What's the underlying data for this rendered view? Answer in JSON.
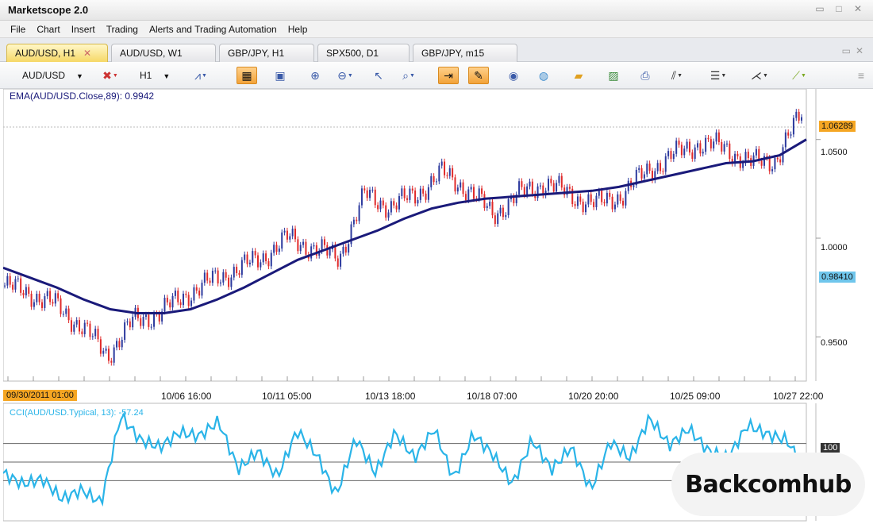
{
  "window": {
    "title": "Marketscope 2.0"
  },
  "menu": [
    "File",
    "Chart",
    "Insert",
    "Trading",
    "Alerts and Trading Automation",
    "Help"
  ],
  "tabs": [
    {
      "label": "AUD/USD, H1",
      "active": true
    },
    {
      "label": "AUD/USD, W1",
      "active": false
    },
    {
      "label": "GBP/JPY, H1",
      "active": false
    },
    {
      "label": "SPX500, D1",
      "active": false
    },
    {
      "label": "GBP/JPY, m15",
      "active": false
    }
  ],
  "toolbar": {
    "instrument": "AUD/USD",
    "timeframe": "H1"
  },
  "main_panel": {
    "indicator_label": "EMA(AUD/USD.Close,89): 0.9942",
    "y_axis_labels": [
      "1.0500",
      "1.0000",
      "0.9500"
    ],
    "price_tags": [
      {
        "text": "1.06289",
        "color": "#f5a623"
      },
      {
        "text": "0.98410",
        "color": "#6fc6ec"
      }
    ],
    "x_axis_labels": [
      "09/30/2011 01:00",
      "10/06 16:00",
      "10/11 05:00",
      "10/13 18:00",
      "10/18 07:00",
      "10/20 20:00",
      "10/25 09:00",
      "10/27 22:00"
    ],
    "ema_color": "#1a1a7a",
    "bull_color": "#2c3a9e",
    "bear_color": "#e02a2a"
  },
  "cci_panel": {
    "indicator_label": "CCI(AUD/USD.Typical, 13): -57.24",
    "level_label": "100",
    "line_color": "#2ab4e8"
  },
  "chart_data": {
    "type": "line",
    "title": "",
    "x_range": [
      "09/30/2011 01:00",
      "10/27 22:00"
    ],
    "ylim": [
      0.93,
      1.07
    ],
    "series": [
      {
        "kind": "ema",
        "values": [
          0.985,
          0.98,
          0.975,
          0.969,
          0.964,
          0.962,
          0.962,
          0.964,
          0.969,
          0.975,
          0.982,
          0.989,
          0.994,
          0.999,
          1.004,
          1.01,
          1.015,
          1.018,
          1.02,
          1.021,
          1.022,
          1.023,
          1.024,
          1.026,
          1.029,
          1.032,
          1.035,
          1.038,
          1.039,
          1.042,
          1.05
        ]
      },
      {
        "kind": "price",
        "values": [
          0.976,
          0.972,
          0.966,
          0.955,
          0.941,
          0.958,
          0.962,
          0.971,
          0.978,
          0.984,
          0.99,
          1.0,
          0.995,
          0.99,
          1.022,
          1.016,
          1.022,
          1.033,
          1.025,
          1.012,
          1.022,
          1.028,
          1.022,
          1.017,
          1.022,
          1.034,
          1.042,
          1.048,
          1.046,
          1.038,
          1.04,
          1.063
        ]
      },
      {
        "kind": "cci",
        "values": [
          -60,
          -120,
          -90,
          -200,
          -150,
          -220,
          250,
          120,
          80,
          160,
          140,
          220,
          -40,
          60,
          -80,
          170,
          40,
          -180,
          130,
          -60,
          160,
          20,
          180,
          -90,
          150,
          40,
          -120,
          120,
          -40,
          80,
          -150,
          110,
          20,
          240,
          90,
          180,
          60,
          20,
          200,
          150,
          120,
          -57
        ]
      }
    ]
  }
}
